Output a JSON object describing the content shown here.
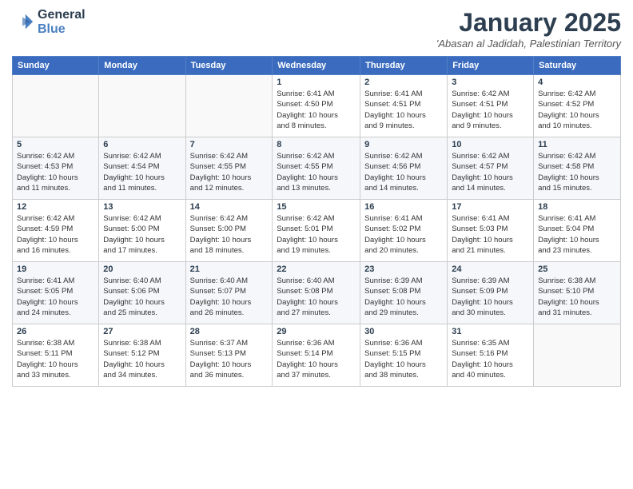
{
  "header": {
    "logo_line1": "General",
    "logo_line2": "Blue",
    "month_title": "January 2025",
    "location": "'Abasan al Jadidah, Palestinian Territory"
  },
  "days_of_week": [
    "Sunday",
    "Monday",
    "Tuesday",
    "Wednesday",
    "Thursday",
    "Friday",
    "Saturday"
  ],
  "weeks": [
    [
      {
        "day": "",
        "info": ""
      },
      {
        "day": "",
        "info": ""
      },
      {
        "day": "",
        "info": ""
      },
      {
        "day": "1",
        "info": "Sunrise: 6:41 AM\nSunset: 4:50 PM\nDaylight: 10 hours\nand 8 minutes."
      },
      {
        "day": "2",
        "info": "Sunrise: 6:41 AM\nSunset: 4:51 PM\nDaylight: 10 hours\nand 9 minutes."
      },
      {
        "day": "3",
        "info": "Sunrise: 6:42 AM\nSunset: 4:51 PM\nDaylight: 10 hours\nand 9 minutes."
      },
      {
        "day": "4",
        "info": "Sunrise: 6:42 AM\nSunset: 4:52 PM\nDaylight: 10 hours\nand 10 minutes."
      }
    ],
    [
      {
        "day": "5",
        "info": "Sunrise: 6:42 AM\nSunset: 4:53 PM\nDaylight: 10 hours\nand 11 minutes."
      },
      {
        "day": "6",
        "info": "Sunrise: 6:42 AM\nSunset: 4:54 PM\nDaylight: 10 hours\nand 11 minutes."
      },
      {
        "day": "7",
        "info": "Sunrise: 6:42 AM\nSunset: 4:55 PM\nDaylight: 10 hours\nand 12 minutes."
      },
      {
        "day": "8",
        "info": "Sunrise: 6:42 AM\nSunset: 4:55 PM\nDaylight: 10 hours\nand 13 minutes."
      },
      {
        "day": "9",
        "info": "Sunrise: 6:42 AM\nSunset: 4:56 PM\nDaylight: 10 hours\nand 14 minutes."
      },
      {
        "day": "10",
        "info": "Sunrise: 6:42 AM\nSunset: 4:57 PM\nDaylight: 10 hours\nand 14 minutes."
      },
      {
        "day": "11",
        "info": "Sunrise: 6:42 AM\nSunset: 4:58 PM\nDaylight: 10 hours\nand 15 minutes."
      }
    ],
    [
      {
        "day": "12",
        "info": "Sunrise: 6:42 AM\nSunset: 4:59 PM\nDaylight: 10 hours\nand 16 minutes."
      },
      {
        "day": "13",
        "info": "Sunrise: 6:42 AM\nSunset: 5:00 PM\nDaylight: 10 hours\nand 17 minutes."
      },
      {
        "day": "14",
        "info": "Sunrise: 6:42 AM\nSunset: 5:00 PM\nDaylight: 10 hours\nand 18 minutes."
      },
      {
        "day": "15",
        "info": "Sunrise: 6:42 AM\nSunset: 5:01 PM\nDaylight: 10 hours\nand 19 minutes."
      },
      {
        "day": "16",
        "info": "Sunrise: 6:41 AM\nSunset: 5:02 PM\nDaylight: 10 hours\nand 20 minutes."
      },
      {
        "day": "17",
        "info": "Sunrise: 6:41 AM\nSunset: 5:03 PM\nDaylight: 10 hours\nand 21 minutes."
      },
      {
        "day": "18",
        "info": "Sunrise: 6:41 AM\nSunset: 5:04 PM\nDaylight: 10 hours\nand 23 minutes."
      }
    ],
    [
      {
        "day": "19",
        "info": "Sunrise: 6:41 AM\nSunset: 5:05 PM\nDaylight: 10 hours\nand 24 minutes."
      },
      {
        "day": "20",
        "info": "Sunrise: 6:40 AM\nSunset: 5:06 PM\nDaylight: 10 hours\nand 25 minutes."
      },
      {
        "day": "21",
        "info": "Sunrise: 6:40 AM\nSunset: 5:07 PM\nDaylight: 10 hours\nand 26 minutes."
      },
      {
        "day": "22",
        "info": "Sunrise: 6:40 AM\nSunset: 5:08 PM\nDaylight: 10 hours\nand 27 minutes."
      },
      {
        "day": "23",
        "info": "Sunrise: 6:39 AM\nSunset: 5:08 PM\nDaylight: 10 hours\nand 29 minutes."
      },
      {
        "day": "24",
        "info": "Sunrise: 6:39 AM\nSunset: 5:09 PM\nDaylight: 10 hours\nand 30 minutes."
      },
      {
        "day": "25",
        "info": "Sunrise: 6:38 AM\nSunset: 5:10 PM\nDaylight: 10 hours\nand 31 minutes."
      }
    ],
    [
      {
        "day": "26",
        "info": "Sunrise: 6:38 AM\nSunset: 5:11 PM\nDaylight: 10 hours\nand 33 minutes."
      },
      {
        "day": "27",
        "info": "Sunrise: 6:38 AM\nSunset: 5:12 PM\nDaylight: 10 hours\nand 34 minutes."
      },
      {
        "day": "28",
        "info": "Sunrise: 6:37 AM\nSunset: 5:13 PM\nDaylight: 10 hours\nand 36 minutes."
      },
      {
        "day": "29",
        "info": "Sunrise: 6:36 AM\nSunset: 5:14 PM\nDaylight: 10 hours\nand 37 minutes."
      },
      {
        "day": "30",
        "info": "Sunrise: 6:36 AM\nSunset: 5:15 PM\nDaylight: 10 hours\nand 38 minutes."
      },
      {
        "day": "31",
        "info": "Sunrise: 6:35 AM\nSunset: 5:16 PM\nDaylight: 10 hours\nand 40 minutes."
      },
      {
        "day": "",
        "info": ""
      }
    ]
  ]
}
